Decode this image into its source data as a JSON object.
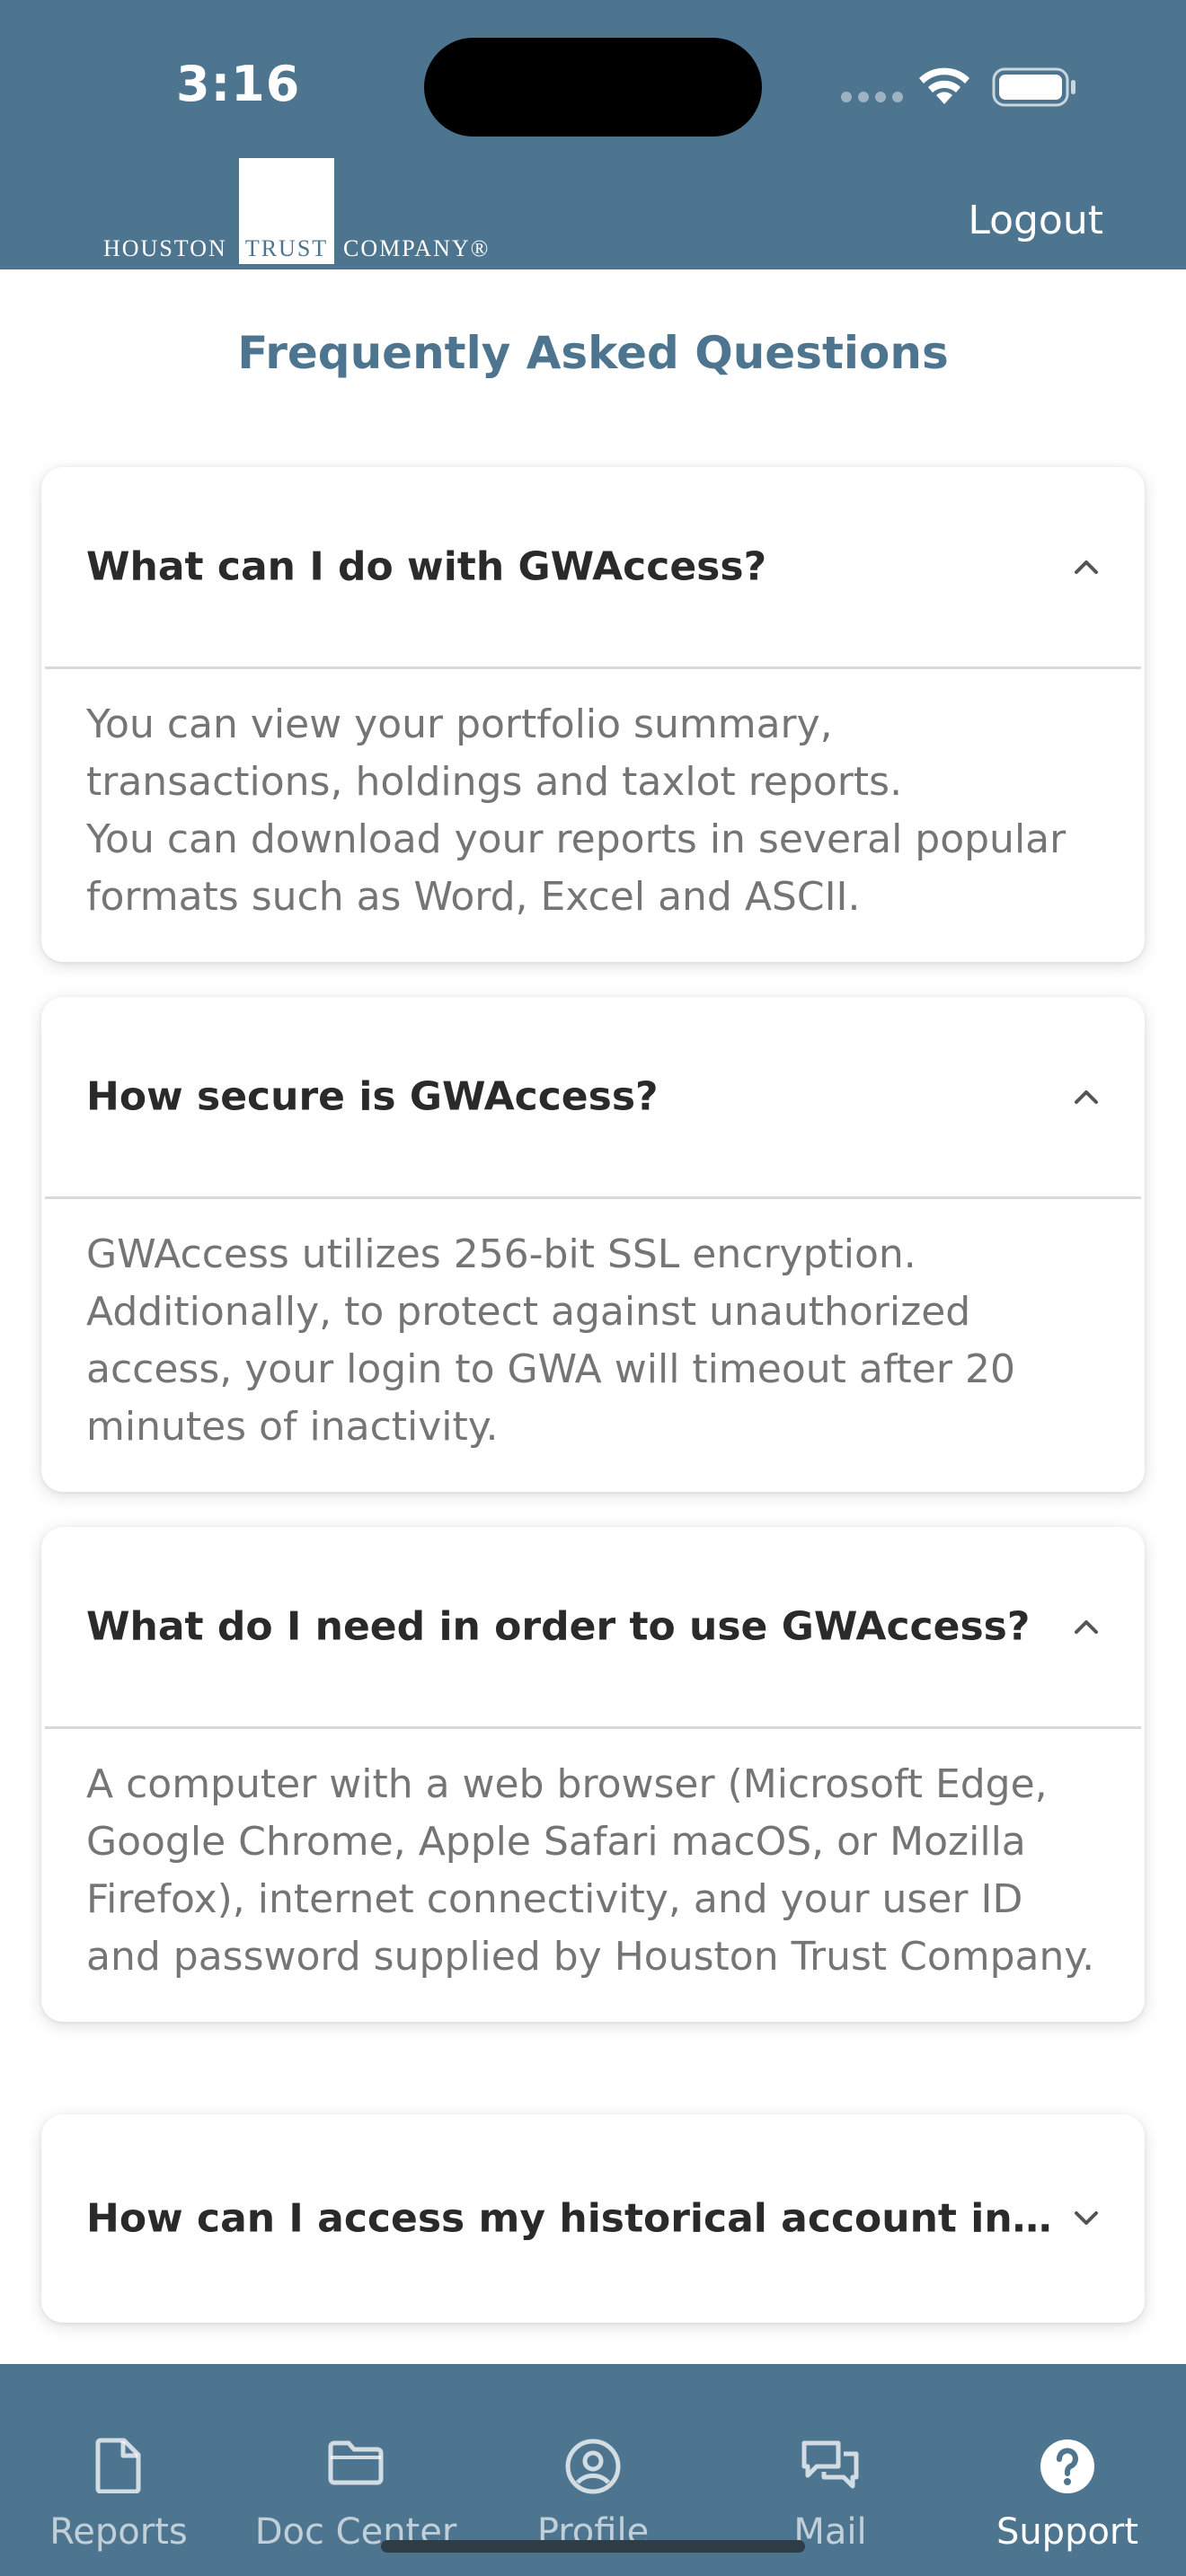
{
  "status_bar": {
    "time": "3:16"
  },
  "header": {
    "logo": {
      "word_left": "HOUSTON",
      "word_center": "TRUST",
      "word_right": "COMPANY®"
    },
    "logout_label": "Logout"
  },
  "page_title": "Frequently Asked Questions",
  "faq": [
    {
      "question": "What can I do with GWAccess?",
      "expanded": true,
      "answer_lines": [
        "You can view your portfolio summary, transactions, holdings and taxlot reports.",
        "You can download your reports in several popular formats such as Word, Excel and ASCII."
      ]
    },
    {
      "question": "How secure is GWAccess?",
      "expanded": true,
      "answer_lines": [
        "GWAccess utilizes 256-bit SSL encryption. Additionally, to protect against unauthorized access, your login to GWA will timeout after 20 minutes of inactivity."
      ]
    },
    {
      "question": "What do I need in order to use GWAccess?",
      "expanded": true,
      "answer_lines": [
        "A computer with a web browser (Microsoft Edge, Google Chrome, Apple Safari macOS, or Mozilla Firefox), internet connectivity, and your user ID and password supplied by Houston Trust Company."
      ]
    },
    {
      "question": "How can I access my historical account inform…",
      "expanded": false,
      "answer_lines": []
    }
  ],
  "tabs": [
    {
      "label": "Reports",
      "icon": "document-icon",
      "active": false
    },
    {
      "label": "Doc Center",
      "icon": "folder-icon",
      "active": false
    },
    {
      "label": "Profile",
      "icon": "user-circle-icon",
      "active": false
    },
    {
      "label": "Mail",
      "icon": "chat-bubbles-icon",
      "active": false
    },
    {
      "label": "Support",
      "icon": "help-circle-icon",
      "active": true
    }
  ],
  "colors": {
    "brand": "#4e758f",
    "question_text": "#2a2a2a",
    "answer_text": "#757575"
  }
}
